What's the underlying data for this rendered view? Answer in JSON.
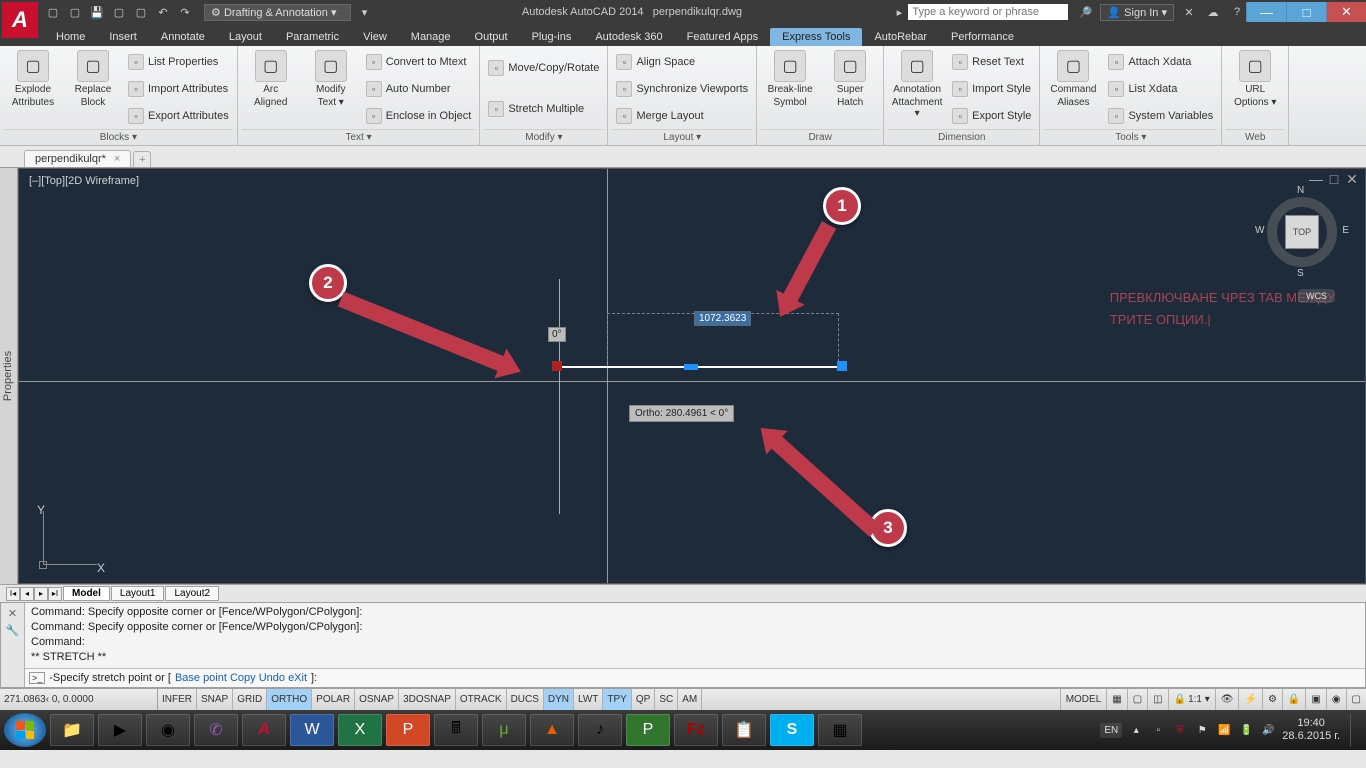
{
  "titlebar": {
    "workspace": "Drafting & Annotation",
    "app": "Autodesk AutoCAD 2014",
    "file": "perpendikulqr.dwg",
    "search_ph": "Type a keyword or phrase",
    "signin": "Sign In"
  },
  "menutabs": [
    "Home",
    "Insert",
    "Annotate",
    "Layout",
    "Parametric",
    "View",
    "Manage",
    "Output",
    "Plug-ins",
    "Autodesk 360",
    "Featured Apps",
    "Express Tools",
    "AutoRebar",
    "Performance"
  ],
  "menutab_active": 11,
  "ribbon": {
    "panels": [
      {
        "title": "Blocks ▾",
        "big": [
          {
            "l1": "Explode",
            "l2": "Attributes"
          },
          {
            "l1": "Replace",
            "l2": "Block"
          }
        ],
        "rows": [
          "List Properties",
          "Import Attributes",
          "Export Attributes"
        ]
      },
      {
        "title": "Text ▾",
        "big": [
          {
            "l1": "Arc",
            "l2": "Aligned"
          },
          {
            "l1": "Modify",
            "l2": "Text ▾"
          }
        ],
        "rows": [
          "Convert to Mtext",
          "Auto Number",
          "Enclose in Object"
        ]
      },
      {
        "title": "Modify ▾",
        "rows": [
          "Move/Copy/Rotate",
          "Stretch Multiple"
        ]
      },
      {
        "title": "Layout ▾",
        "rows": [
          "Align Space",
          "Synchronize Viewports",
          "Merge Layout"
        ]
      },
      {
        "title": "Draw",
        "big": [
          {
            "l1": "Break-line",
            "l2": "Symbol"
          },
          {
            "l1": "Super",
            "l2": "Hatch"
          }
        ]
      },
      {
        "title": "Dimension",
        "big": [
          {
            "l1": "Annotation",
            "l2": "Attachment ▾"
          }
        ],
        "rows": [
          "Reset Text",
          "Import Style",
          "Export Style"
        ]
      },
      {
        "title": "Tools ▾",
        "big": [
          {
            "l1": "Command",
            "l2": "Aliases"
          }
        ],
        "rows": [
          "Attach Xdata",
          "List Xdata",
          "System Variables"
        ]
      },
      {
        "title": "Web",
        "big": [
          {
            "l1": "URL",
            "l2": "Options ▾"
          }
        ]
      }
    ]
  },
  "filetab": "perpendikulqr*",
  "viewport_label": "[–][Top][2D Wireframe]",
  "viewcube": {
    "face": "TOP",
    "n": "N",
    "s": "S",
    "e": "E",
    "w": "W",
    "wcs": "WCS"
  },
  "angle_box": "0°",
  "value_box": "1072.3623",
  "ortho_tip": "Ortho: 280.4961 < 0°",
  "overlay_l1": "ПРЕВКЛЮЧВАНЕ ЧРЕЗ TAB МЕЖДУ",
  "overlay_l2": "ТРИТЕ ОПЦИИ.|",
  "callouts": {
    "c1": "1",
    "c2": "2",
    "c3": "3"
  },
  "layout_tabs": [
    "Model",
    "Layout1",
    "Layout2"
  ],
  "cmd_hist": [
    "Command: Specify opposite corner or [Fence/WPolygon/CPolygon]:",
    "Command: Specify opposite corner or [Fence/WPolygon/CPolygon]:",
    "Command:",
    "** STRETCH **"
  ],
  "cmd_prompt_pre": "-Specify stretch point or [",
  "cmd_prompt_opts": "Base point Copy Undo eXit",
  "cmd_prompt_post": "]:",
  "status": {
    "coords": "271.0863‹ 0, 0.0000",
    "toggles": [
      "INFER",
      "SNAP",
      "GRID",
      "ORTHO",
      "POLAR",
      "OSNAP",
      "3DOSNAP",
      "OTRACK",
      "DUCS",
      "DYN",
      "LWT",
      "TPY",
      "QP",
      "SC",
      "AM"
    ],
    "on": [
      3,
      9,
      11
    ],
    "model": "MODEL",
    "scale": "1:1 ▾"
  },
  "tray": {
    "lang": "EN",
    "time": "19:40",
    "date": "28.6.2015 г."
  }
}
